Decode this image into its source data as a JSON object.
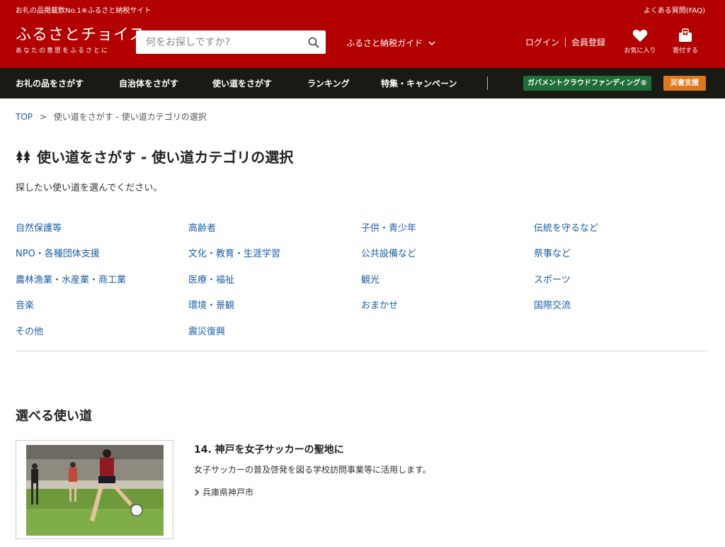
{
  "topbar": {
    "left": "お礼の品掲載数No.1※ふるさと納税サイト",
    "faq": "よくある質問(FAQ)"
  },
  "header": {
    "logo": "ふるさとチョイス",
    "logo_sub": "あなたの意思をふるさとに",
    "search_placeholder": "何をお探しですか?",
    "guide": "ふるさと納税ガイド",
    "login": "ログイン",
    "register": "会員登録",
    "favorites": "お気に入り",
    "donate": "寄付する"
  },
  "nav": {
    "items": [
      "お礼の品をさがす",
      "自治体をさがす",
      "使い道をさがす",
      "ランキング",
      "特集・キャンペーン"
    ],
    "gcf": "ガバメントクラウドファンディング®",
    "disaster": "災害支援"
  },
  "breadcrumb": {
    "top": "TOP",
    "separator": ">",
    "current": "使い道をさがす - 使い道カテゴリの選択"
  },
  "page": {
    "title": "使い道をさがす - 使い道カテゴリの選択",
    "intro": "探したい使い道を選んでください。"
  },
  "categories": [
    "自然保護等",
    "高齢者",
    "子供・青少年",
    "伝統を守るなど",
    "NPO・各種団体支援",
    "文化・教育・生涯学習",
    "公共設備など",
    "祭事など",
    "農林漁業・水産業・商工業",
    "医療・福祉",
    "観光",
    "スポーツ",
    "音楽",
    "環境・景観",
    "おまかせ",
    "国際交流",
    "その他",
    "震災復興"
  ],
  "section": {
    "title": "選べる使い道"
  },
  "project": {
    "title": "14. 神戸を女子サッカーの聖地に",
    "desc": "女子サッカーの普及啓発を図る学校訪問事業等に活用します。",
    "location": "兵庫県神戸市"
  },
  "colors": {
    "brand_red": "#b30000",
    "nav_dark": "#1a1a14",
    "link_blue": "#1b5ea8",
    "gcf_green": "#1f6e3a",
    "disaster_orange": "#e0781e"
  }
}
